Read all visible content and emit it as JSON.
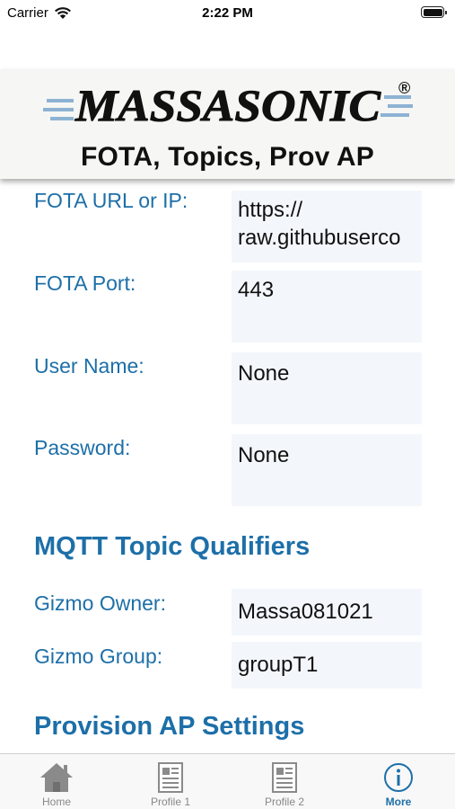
{
  "status_bar": {
    "carrier": "Carrier",
    "time": "2:22 PM"
  },
  "header": {
    "logo_text": "MASSASONIC",
    "logo_registered": "®",
    "title": "FOTA, Topics, Prov AP"
  },
  "fota": {
    "url": {
      "label": "FOTA URL or IP:",
      "value": "https:// raw.githubuserco"
    },
    "port": {
      "label": "FOTA Port:",
      "value": "443"
    },
    "user": {
      "label": "User Name:",
      "value": "None"
    },
    "password": {
      "label": "Password:",
      "value": "None"
    }
  },
  "mqtt": {
    "title": "MQTT Topic Qualifiers",
    "owner": {
      "label": "Gizmo Owner:",
      "value": "Massa081021"
    },
    "group": {
      "label": "Gizmo Group:",
      "value": "groupT1"
    }
  },
  "provision": {
    "title": "Provision AP Settings"
  },
  "tabs": [
    {
      "label": "Home",
      "icon": "home-icon",
      "active": false
    },
    {
      "label": "Profile 1",
      "icon": "document-icon",
      "active": false
    },
    {
      "label": "Profile 2",
      "icon": "document-icon",
      "active": false
    },
    {
      "label": "More",
      "icon": "info-icon",
      "active": true
    }
  ],
  "colors": {
    "accent": "#1d6fa8",
    "field_bg": "#f3f7fb",
    "tab_inactive": "#888888"
  }
}
